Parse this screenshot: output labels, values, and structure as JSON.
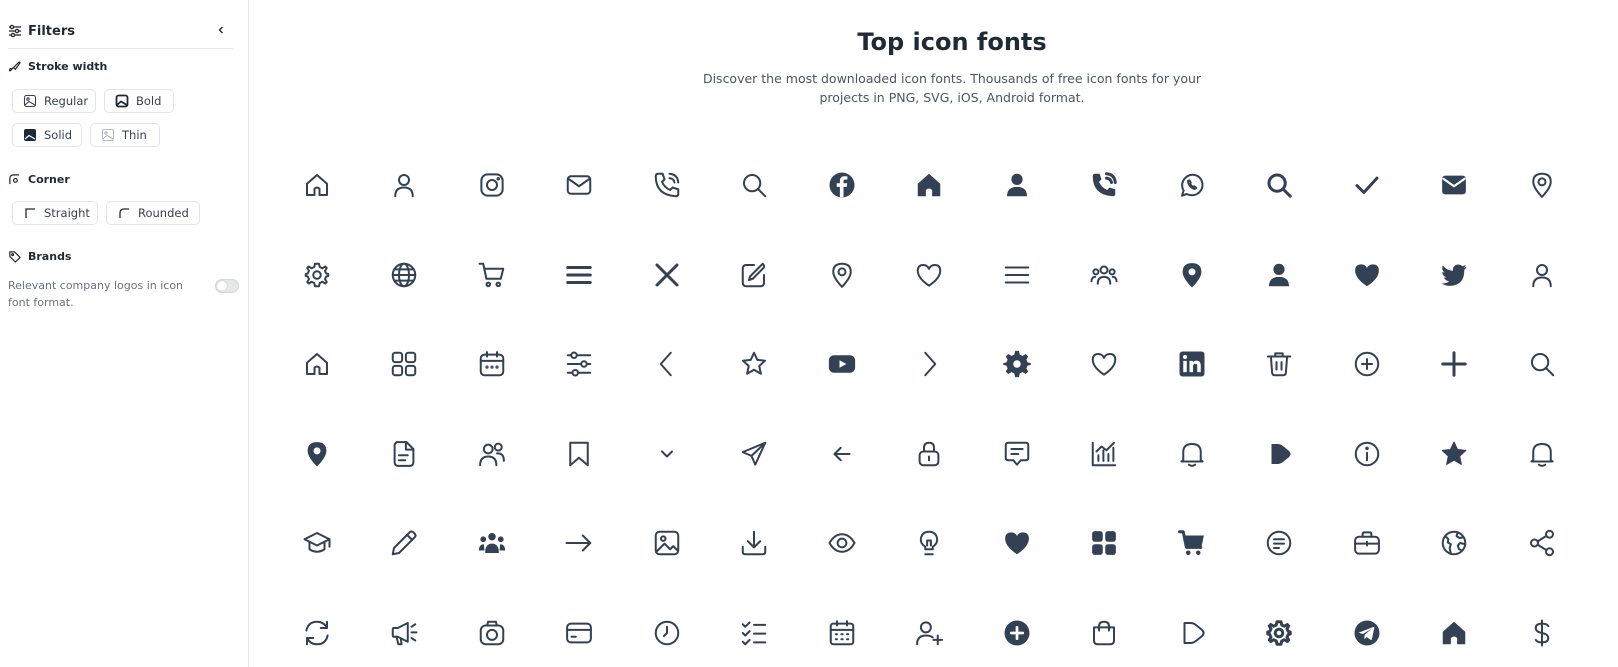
{
  "sidebar": {
    "title": "Filters",
    "stroke_width": {
      "title": "Stroke width",
      "options": [
        "Regular",
        "Bold",
        "Solid",
        "Thin"
      ]
    },
    "corner": {
      "title": "Corner",
      "options": [
        "Straight",
        "Rounded"
      ]
    },
    "brands": {
      "title": "Brands",
      "description": "Relevant company logos in icon font format.",
      "toggle_on": false
    }
  },
  "main": {
    "title": "Top icon fonts",
    "subtitle": "Discover the most downloaded icon fonts. Thousands of free icon fonts for your projects in PNG, SVG, iOS, Android format."
  },
  "colors": {
    "icon": "#334155",
    "text": "#1f2a37",
    "muted": "#4b5563",
    "border": "#e5e7eb"
  },
  "icon_rows": [
    [
      "home",
      "user",
      "instagram",
      "envelope",
      "phone-call",
      "search",
      "facebook",
      "home-solid",
      "user-solid",
      "phone-call-solid",
      "whatsapp",
      "search-bold",
      "check",
      "envelope-solid",
      "marker"
    ],
    [
      "settings",
      "globe",
      "shopping-cart",
      "menu-burger",
      "cross",
      "edit",
      "marker",
      "heart",
      "menu-lines",
      "users",
      "marker-solid",
      "user-solid",
      "heart-solid",
      "twitter",
      "user"
    ],
    [
      "home",
      "apps",
      "calendar",
      "settings-sliders",
      "angle-left",
      "star",
      "youtube",
      "angle-right",
      "settings-solid",
      "heart",
      "linkedin",
      "trash",
      "add",
      "plus",
      "search"
    ],
    [
      "marker-solid",
      "document",
      "users-alt",
      "bookmark",
      "angle-small-down",
      "paper-plane",
      "arrow-small-left",
      "lock",
      "comment-alt",
      "stats",
      "bell",
      "play-solid",
      "info",
      "star-solid",
      "bell"
    ],
    [
      "graduation-cap",
      "pencil",
      "users-solid",
      "arrow-right",
      "picture",
      "download",
      "eye",
      "bulb",
      "heart-solid",
      "apps-solid",
      "shopping-cart-solid",
      "comment-lines",
      "briefcase",
      "earth",
      "share"
    ],
    [
      "refresh",
      "megaphone",
      "camera",
      "credit-card",
      "clock",
      "list-check",
      "calendar-lines",
      "user-add",
      "add-solid",
      "shopping-bag",
      "play",
      "settings-bold",
      "telegram",
      "home-solid",
      "dollar"
    ]
  ]
}
